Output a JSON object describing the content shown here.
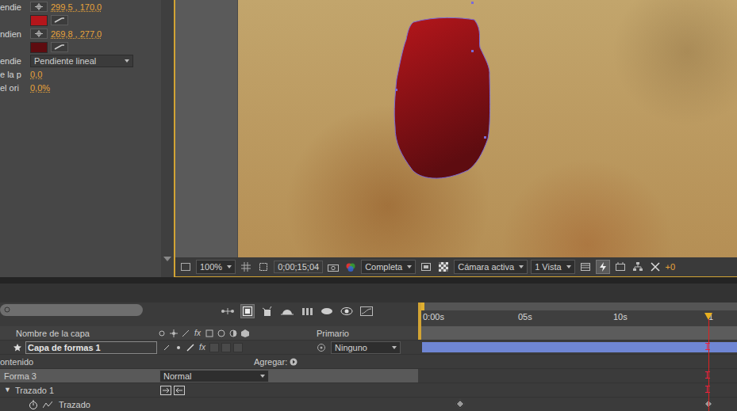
{
  "effect_controls": {
    "rows": [
      {
        "label": "endie",
        "kind": "point",
        "value": "299,5 , 170,0"
      },
      {
        "label": "",
        "kind": "color",
        "color": "#b5161b"
      },
      {
        "label": "ndien",
        "kind": "point",
        "value": "269,8 , 277,0"
      },
      {
        "label": "",
        "kind": "color",
        "color": "#5e0c10"
      },
      {
        "label": "endie",
        "kind": "select",
        "value": "Pendiente lineal"
      },
      {
        "label": "e la p",
        "kind": "number",
        "value": "0,0"
      },
      {
        "label": "el ori",
        "kind": "number",
        "value": "0,0%"
      }
    ]
  },
  "viewer": {
    "zoom": "100%",
    "timecode": "0;00;15;04",
    "resolution": "Completa",
    "camera": "Cámara activa",
    "views": "1 Vista",
    "exposure": "+0"
  },
  "timeline": {
    "ruler": [
      "0:00s",
      "05s",
      "10s",
      "1"
    ],
    "playhead_level": 0.91,
    "columns": [
      "Nombre de la capa",
      "Primario"
    ],
    "rows": [
      {
        "kind": "layer",
        "name": "Capa de formas 1",
        "parent": "Ninguno",
        "selected": false,
        "marker": true
      },
      {
        "kind": "group",
        "label": "ontenido",
        "action": "Agregar:",
        "selected": false,
        "marker": false
      },
      {
        "kind": "shape",
        "label": "Forma 3",
        "mode": "Normal",
        "selected": true,
        "marker": true
      },
      {
        "kind": "path-group",
        "label": "Trazado 1",
        "toggle": "▼",
        "expanded": true,
        "selected": false,
        "marker": true
      },
      {
        "kind": "property",
        "label": "Trazado",
        "selected": false,
        "marker": false,
        "keyframes": [
          0.132,
          0.91
        ]
      }
    ]
  }
}
